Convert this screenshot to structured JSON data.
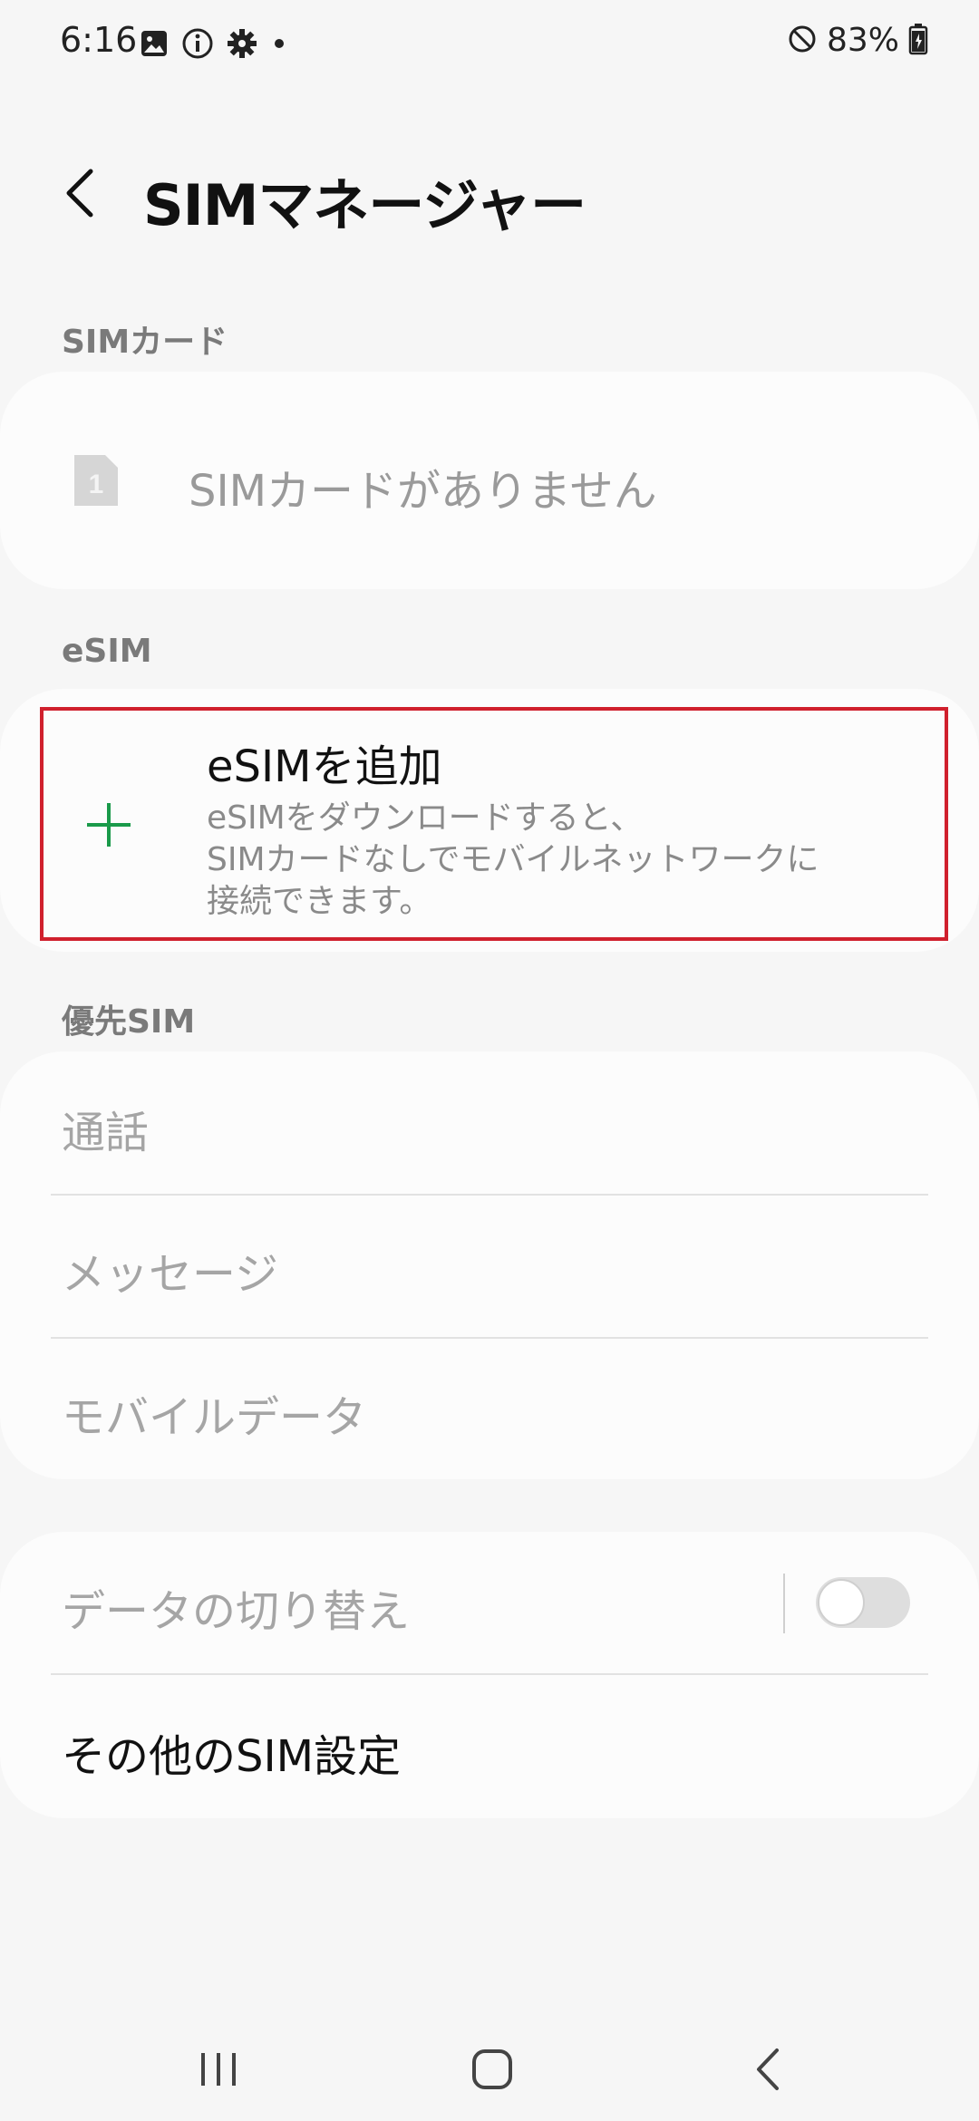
{
  "status_bar": {
    "time": "6:16",
    "battery": "83%",
    "icons_left": [
      "gallery-icon",
      "info-icon",
      "settings-gear-icon",
      "dot-icon"
    ],
    "icons_right": [
      "do-not-disturb-icon",
      "battery-icon"
    ]
  },
  "header": {
    "title": "SIMマネージャー"
  },
  "sim_card_section": {
    "header": "SIMカード",
    "slot_number": "1",
    "empty_label": "SIMカードがありません"
  },
  "esim_section": {
    "header": "eSIM",
    "add_title": "eSIMを追加",
    "add_desc_line1": "eSIMをダウンロードすると、",
    "add_desc_line2": "SIMカードなしでモバイルネットワークに",
    "add_desc_line3": "接続できます。",
    "accent_color": "#1a9a4a",
    "highlight_color": "#d0202d"
  },
  "preferred_sim_section": {
    "header": "優先SIM",
    "items": [
      {
        "label": "通話"
      },
      {
        "label": "メッセージ"
      },
      {
        "label": "モバイルデータ"
      }
    ]
  },
  "bottom_section": {
    "data_switch_label": "データの切り替え",
    "data_switch_state": "off",
    "other_settings_label": "その他のSIM設定"
  },
  "nav_bar": {
    "buttons": [
      "recent-apps-icon",
      "home-icon",
      "back-icon"
    ]
  }
}
